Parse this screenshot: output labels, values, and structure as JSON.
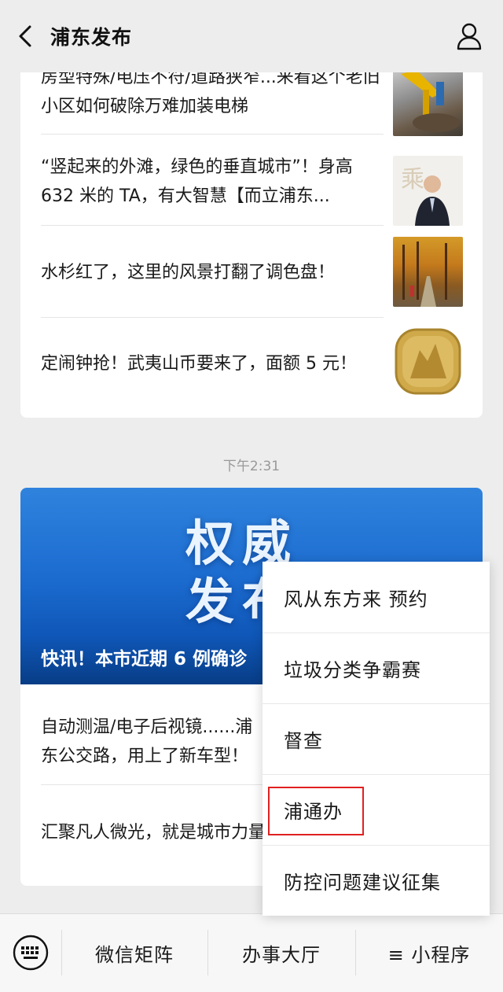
{
  "header": {
    "title": "浦东发布"
  },
  "articles": [
    {
      "title": "房型特殊/电压不符/道路狭窄...来看这个老旧小区如何破除万难加装电梯"
    },
    {
      "title": "“竖起来的外滩，绿色的垂直城市”！身高 632 米的 TA，有大智慧【而立浦东..."
    },
    {
      "title": "水杉红了，这里的风景打翻了调色盘！"
    },
    {
      "title": "定闹钟抢！武夷山币要来了，面额 5 元！"
    }
  ],
  "time": "下午2:31",
  "card2": {
    "banner_line1": "权威",
    "banner_line2": "发布",
    "headline": "快讯！本市近期 6 例确诊",
    "items": [
      {
        "title": "自动测温/电子后视镜......浦东公交路，用上了新车型！"
      },
      {
        "title": "汇聚凡人微光，就是城市力量"
      }
    ]
  },
  "menu": {
    "items": [
      {
        "label": "风从东方来 预约"
      },
      {
        "label": "垃圾分类争霸赛"
      },
      {
        "label": "督查"
      },
      {
        "label": "浦通办"
      },
      {
        "label": "防控问题建议征集"
      }
    ],
    "highlight_color": "#e02020"
  },
  "bottom_bar": {
    "tabs": [
      {
        "label": "微信矩阵"
      },
      {
        "label": "办事大厅"
      },
      {
        "label": "≡ 小程序"
      }
    ]
  },
  "colors": {
    "background": "#ededed",
    "banner_blue": "#1c6cd0"
  }
}
